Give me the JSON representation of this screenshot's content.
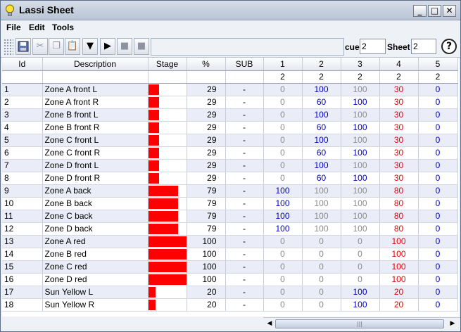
{
  "app": {
    "title": "Lassi Sheet"
  },
  "window_controls": {
    "minimize": "_",
    "maximize": "□",
    "close": "✕"
  },
  "menu": [
    "File",
    "Edit",
    "Tools"
  ],
  "toolbar": {
    "cue_label": "cue",
    "cue_value": "2",
    "sheet_label": "Sheet",
    "sheet_value": "2",
    "help": "?"
  },
  "colors": {
    "stage_bar": "#ff0000",
    "zero": "#8a8a8a",
    "blue": "#0000c8",
    "red": "#e00000"
  },
  "columns": [
    "Id",
    "Description",
    "Stage",
    "%",
    "SUB",
    "1",
    "2",
    "3",
    "4",
    "5"
  ],
  "sub_header": [
    "",
    "",
    "",
    "",
    "",
    "2",
    "2",
    "2",
    "2",
    "2"
  ],
  "rows": [
    {
      "id": "1",
      "desc": "Zone A front L",
      "stage": 29,
      "pct": "29",
      "sub": "-",
      "v": [
        "0",
        "100",
        "100",
        "30",
        "0"
      ]
    },
    {
      "id": "2",
      "desc": "Zone A front R",
      "stage": 29,
      "pct": "29",
      "sub": "-",
      "v": [
        "0",
        "60",
        "100",
        "30",
        "0"
      ]
    },
    {
      "id": "3",
      "desc": "Zone B front L",
      "stage": 29,
      "pct": "29",
      "sub": "-",
      "v": [
        "0",
        "100",
        "100",
        "30",
        "0"
      ]
    },
    {
      "id": "4",
      "desc": "Zone B front R",
      "stage": 29,
      "pct": "29",
      "sub": "-",
      "v": [
        "0",
        "60",
        "100",
        "30",
        "0"
      ]
    },
    {
      "id": "5",
      "desc": "Zone C front L",
      "stage": 29,
      "pct": "29",
      "sub": "-",
      "v": [
        "0",
        "100",
        "100",
        "30",
        "0"
      ]
    },
    {
      "id": "6",
      "desc": "Zone C front R",
      "stage": 29,
      "pct": "29",
      "sub": "-",
      "v": [
        "0",
        "60",
        "100",
        "30",
        "0"
      ]
    },
    {
      "id": "7",
      "desc": "Zone D front L",
      "stage": 29,
      "pct": "29",
      "sub": "-",
      "v": [
        "0",
        "100",
        "100",
        "30",
        "0"
      ]
    },
    {
      "id": "8",
      "desc": "Zone D front R",
      "stage": 29,
      "pct": "29",
      "sub": "-",
      "v": [
        "0",
        "60",
        "100",
        "30",
        "0"
      ]
    },
    {
      "id": "9",
      "desc": "Zone A back",
      "stage": 79,
      "pct": "79",
      "sub": "-",
      "v": [
        "100",
        "100",
        "100",
        "80",
        "0"
      ]
    },
    {
      "id": "10",
      "desc": "Zone B back",
      "stage": 79,
      "pct": "79",
      "sub": "-",
      "v": [
        "100",
        "100",
        "100",
        "80",
        "0"
      ]
    },
    {
      "id": "11",
      "desc": "Zone C back",
      "stage": 79,
      "pct": "79",
      "sub": "-",
      "v": [
        "100",
        "100",
        "100",
        "80",
        "0"
      ]
    },
    {
      "id": "12",
      "desc": "Zone D back",
      "stage": 79,
      "pct": "79",
      "sub": "-",
      "v": [
        "100",
        "100",
        "100",
        "80",
        "0"
      ]
    },
    {
      "id": "13",
      "desc": "Zone A red",
      "stage": 100,
      "pct": "100",
      "sub": "-",
      "v": [
        "0",
        "0",
        "0",
        "100",
        "0"
      ]
    },
    {
      "id": "14",
      "desc": "Zone B red",
      "stage": 100,
      "pct": "100",
      "sub": "-",
      "v": [
        "0",
        "0",
        "0",
        "100",
        "0"
      ]
    },
    {
      "id": "15",
      "desc": "Zone C red",
      "stage": 100,
      "pct": "100",
      "sub": "-",
      "v": [
        "0",
        "0",
        "0",
        "100",
        "0"
      ]
    },
    {
      "id": "16",
      "desc": "Zone D red",
      "stage": 100,
      "pct": "100",
      "sub": "-",
      "v": [
        "0",
        "0",
        "0",
        "100",
        "0"
      ]
    },
    {
      "id": "17",
      "desc": "Sun Yellow L",
      "stage": 20,
      "pct": "20",
      "sub": "-",
      "v": [
        "0",
        "0",
        "100",
        "20",
        "0"
      ]
    },
    {
      "id": "18",
      "desc": "Sun Yellow R",
      "stage": 20,
      "pct": "20",
      "sub": "-",
      "v": [
        "0",
        "0",
        "100",
        "20",
        "0"
      ]
    }
  ],
  "cell_colors": [
    [
      "zero",
      "blue",
      "zero",
      "red",
      "blue"
    ],
    [
      "zero",
      "blue",
      "blue",
      "red",
      "blue"
    ],
    [
      "zero",
      "blue",
      "zero",
      "red",
      "blue"
    ],
    [
      "zero",
      "blue",
      "blue",
      "red",
      "blue"
    ],
    [
      "zero",
      "blue",
      "zero",
      "red",
      "blue"
    ],
    [
      "zero",
      "blue",
      "blue",
      "red",
      "blue"
    ],
    [
      "zero",
      "blue",
      "zero",
      "red",
      "blue"
    ],
    [
      "zero",
      "blue",
      "blue",
      "red",
      "blue"
    ],
    [
      "blue",
      "zero",
      "zero",
      "red",
      "blue"
    ],
    [
      "blue",
      "zero",
      "zero",
      "red",
      "blue"
    ],
    [
      "blue",
      "zero",
      "zero",
      "red",
      "blue"
    ],
    [
      "blue",
      "zero",
      "zero",
      "red",
      "blue"
    ],
    [
      "zero",
      "zero",
      "zero",
      "red",
      "blue"
    ],
    [
      "zero",
      "zero",
      "zero",
      "red",
      "blue"
    ],
    [
      "zero",
      "zero",
      "zero",
      "red",
      "blue"
    ],
    [
      "zero",
      "zero",
      "zero",
      "red",
      "blue"
    ],
    [
      "zero",
      "zero",
      "blue",
      "red",
      "blue"
    ],
    [
      "zero",
      "zero",
      "blue",
      "red",
      "blue"
    ]
  ]
}
